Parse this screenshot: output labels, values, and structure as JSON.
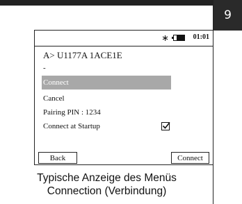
{
  "page_number": "9",
  "screen": {
    "status": {
      "bluetooth_symbol": "∗",
      "clock": "01:01",
      "battery_level": 0.75
    },
    "device_address": "A> U1177A 1ACE1E",
    "separator": "-",
    "menu": [
      {
        "label": "Connect",
        "selected": true
      },
      {
        "label": "Cancel",
        "selected": false
      },
      {
        "label": "Pairing PIN : 1234",
        "selected": false
      },
      {
        "label": "Connect at Startup",
        "selected": false,
        "checked": true
      }
    ],
    "softkeys": {
      "left": "Back",
      "right": "Connect"
    }
  },
  "caption": {
    "line1": "Typische Anzeige des Menüs",
    "line2": "Connection (Verbindung)"
  }
}
